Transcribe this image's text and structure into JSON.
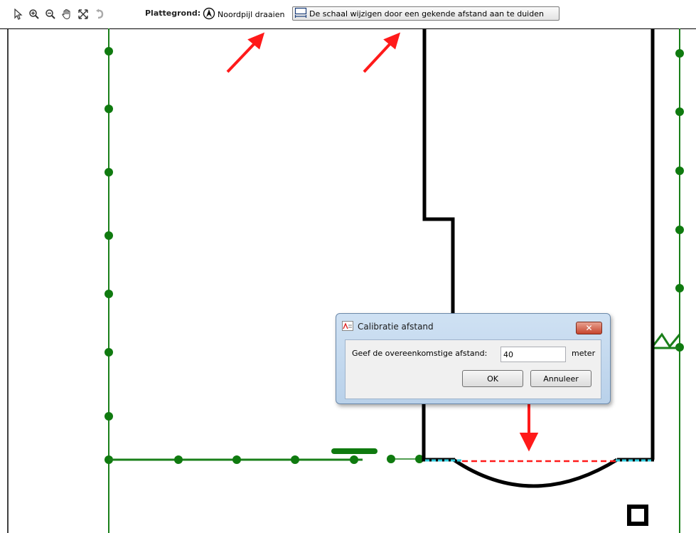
{
  "toolbar": {
    "tools": [
      {
        "icon": "select-arrow-icon"
      },
      {
        "icon": "zoom-in-icon"
      },
      {
        "icon": "zoom-out-icon"
      },
      {
        "icon": "pan-hand-icon"
      },
      {
        "icon": "fit-extent-icon"
      },
      {
        "icon": "undo-icon"
      }
    ],
    "section_label": "Plattegrond:",
    "rotate_north_label": "Noordpijl draaien",
    "rotate_north_icon": "north-arrow-icon",
    "scale_button_label": "De schaal wijzigen door een gekende afstand aan te duiden",
    "scale_button_icon": "scale-measure-icon"
  },
  "dialog": {
    "title": "Calibratie afstand",
    "prompt": "Geef de overeenkomstige afstand:",
    "distance_value": "40",
    "unit": "meter",
    "ok_label": "OK",
    "cancel_label": "Annuleer",
    "close_icon": "close-icon"
  },
  "colors": {
    "plan_green": "#1a7f1a",
    "wall_black": "#000000",
    "annotation_red": "#ff1a1a",
    "highlight_cyan": "#33ccdd"
  }
}
